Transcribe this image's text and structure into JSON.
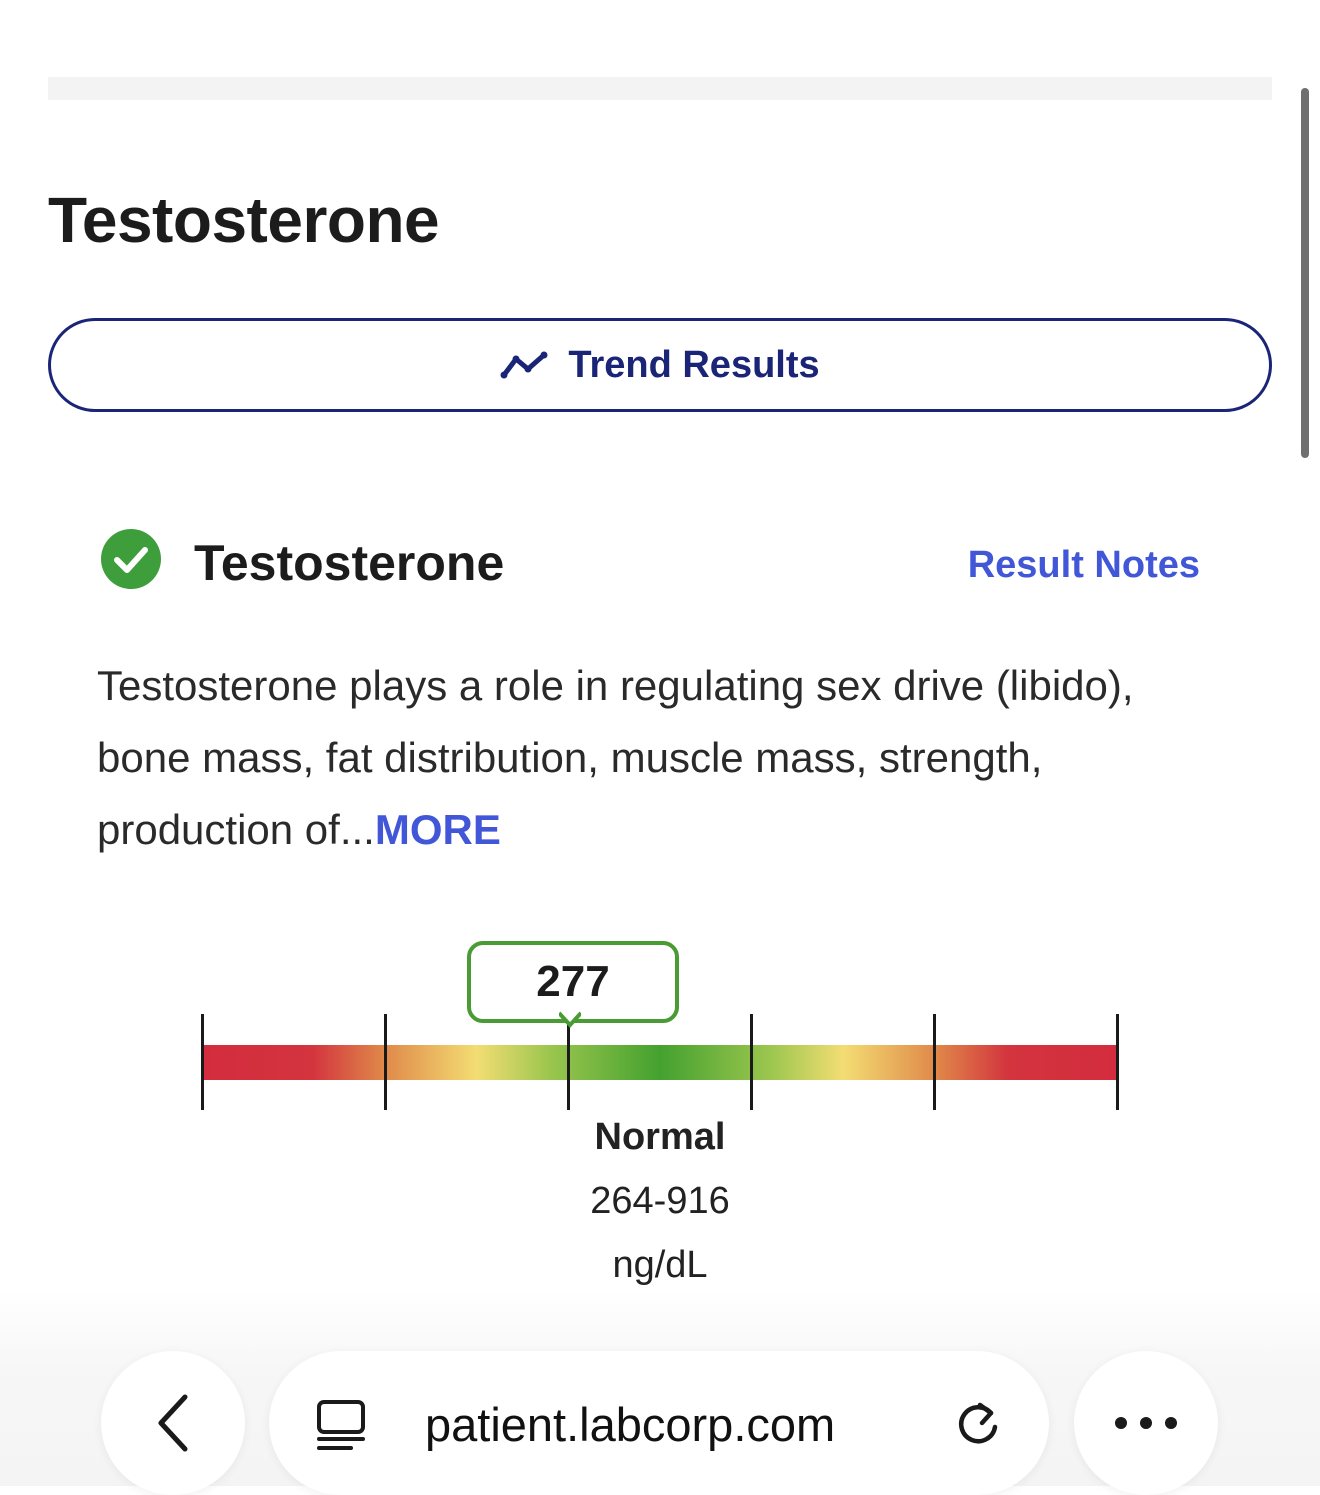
{
  "page": {
    "title": "Testosterone"
  },
  "trend_button": {
    "label": "Trend Results",
    "icon": "trend-line-icon"
  },
  "result": {
    "status_icon": "check-circle-icon",
    "name": "Testosterone",
    "notes_link": "Result Notes",
    "description": "Testosterone plays a role in regulating sex drive (libido), bone mass, fat distribution, muscle mass, strength, production of...",
    "more_link": "MORE",
    "value": "277",
    "range_status": "Normal",
    "range_values": "264-916",
    "units": "ng/dL",
    "gauge": {
      "value": 277,
      "normal_low": 264,
      "normal_high": 916,
      "segments": 5,
      "colors": {
        "out_of_range": "#d32c3e",
        "borderline": "#f3dd73",
        "normal": "#44a12f",
        "bubble_border": "#4a9b33"
      }
    }
  },
  "browser": {
    "url": "patient.labcorp.com",
    "back_icon": "chevron-left-icon",
    "reader_icon": "reader-mode-icon",
    "reload_icon": "reload-icon",
    "more_icon": "ellipsis-icon"
  },
  "colors": {
    "brand_navy": "#1b2577",
    "link_blue": "#4257d8",
    "success_green": "#3e9e3b"
  }
}
